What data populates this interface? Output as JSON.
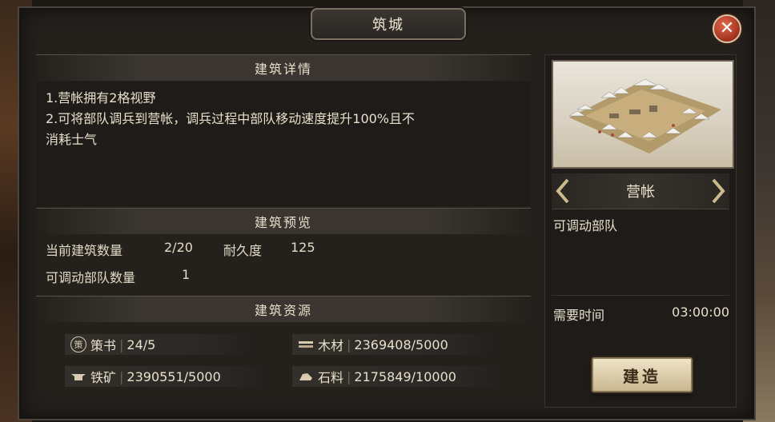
{
  "dialog": {
    "title": "筑城",
    "close_symbol": "✕"
  },
  "details": {
    "header": "建筑详情",
    "lines": [
      "1.营帐拥有2格视野",
      "2.可将部队调兵到营帐，调兵过程中部队移动速度提升100%且不",
      "消耗士气"
    ]
  },
  "preview": {
    "header": "建筑预览",
    "count_label": "当前建筑数量",
    "count_value": "2/20",
    "durability_label": "耐久度",
    "durability_value": "125",
    "troops_label": "可调动部队数量",
    "troops_value": "1"
  },
  "resources": {
    "header": "建筑资源",
    "items": [
      {
        "icon": "strategy-book-icon",
        "icon_glyph": "策",
        "name": "策书",
        "value": "24/5"
      },
      {
        "icon": "wood-icon",
        "icon_glyph": "",
        "name": "木材",
        "value": "2369408/5000"
      },
      {
        "icon": "iron-icon",
        "icon_glyph": "",
        "name": "铁矿",
        "value": "2390551/5000"
      },
      {
        "icon": "stone-icon",
        "icon_glyph": "",
        "name": "石料",
        "value": "2175849/10000"
      }
    ]
  },
  "building": {
    "name": "营帐",
    "description": "可调动部队",
    "time_label": "需要时间",
    "time_value": "03:00:00",
    "build_label": "建造"
  },
  "colors": {
    "panel": "#24211d",
    "text": "#e8e0cc",
    "close": "#c0402a",
    "button": "#e0d2b0"
  }
}
